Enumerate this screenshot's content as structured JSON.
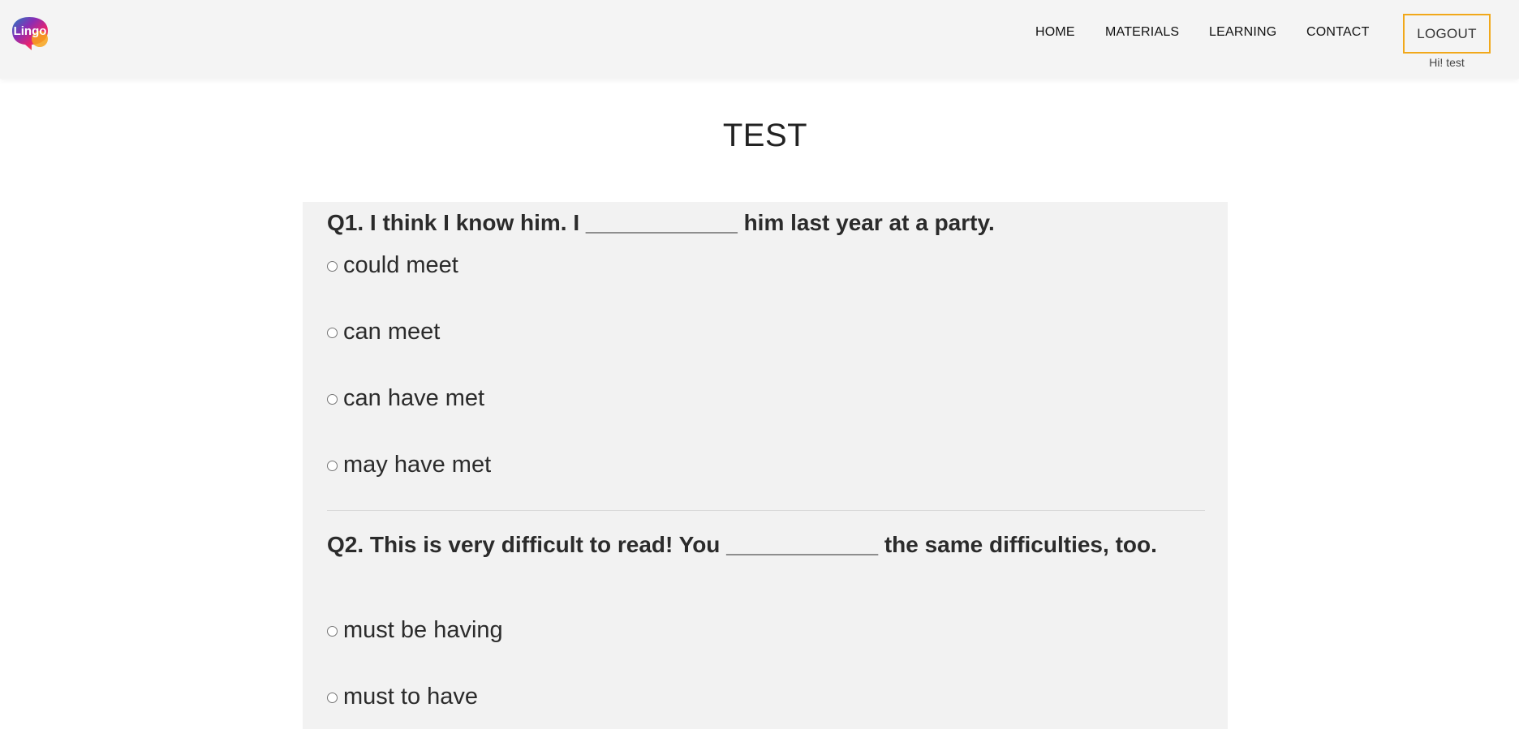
{
  "header": {
    "logo_text": "Lingo",
    "nav": {
      "home": "HOME",
      "materials": "MATERIALS",
      "learning": "LEARNING",
      "contact": "CONTACT"
    },
    "logout_label": "LOGOUT",
    "greeting": "Hi! test",
    "accent_color": "#f1a81a"
  },
  "page": {
    "title": "TEST"
  },
  "questions": [
    {
      "text": "Q1. I think I know him. I ____________ him last year at a party.",
      "options": [
        "could meet",
        "can meet",
        "can have met",
        "may have met"
      ]
    },
    {
      "text": "Q2. This is very difficult to read! You ____________ the same difficulties, too.",
      "options": [
        "must be having",
        "must to have"
      ]
    }
  ]
}
